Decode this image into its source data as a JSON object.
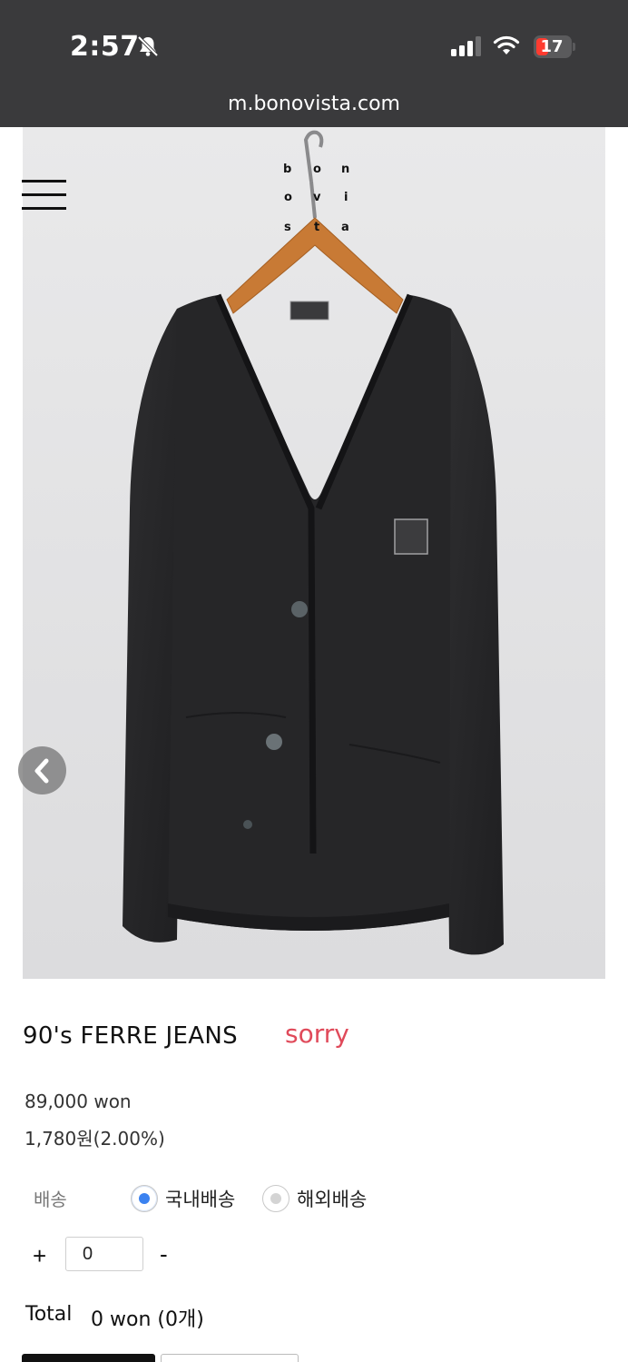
{
  "status_bar": {
    "time": "2:57",
    "battery": "17",
    "url": "m.bonovista.com"
  },
  "logo": {
    "letters": [
      "b",
      "o",
      "n",
      "o",
      "v",
      "i",
      "s",
      "t",
      "a"
    ]
  },
  "product": {
    "title": "90's FERRE JEANS",
    "status": "sorry",
    "price": "89,000 won",
    "points": "1,780원(2.00%)"
  },
  "shipping": {
    "label": "배송",
    "options": [
      {
        "label": "국내배송",
        "selected": true
      },
      {
        "label": "해외배송",
        "selected": false
      }
    ]
  },
  "quantity": {
    "plus": "+",
    "value": "0",
    "minus": "-"
  },
  "total": {
    "label": "Total",
    "value": "0 won (0개)"
  },
  "icons": {
    "menu": "hamburger-menu-icon",
    "prev": "chevron-left-icon",
    "bell": "bell-slash-icon",
    "signal": "cellular-signal-icon",
    "wifi": "wifi-icon",
    "battery": "battery-icon"
  },
  "colors": {
    "status_bar_bg": "#3a3a3c",
    "sorry": "#e04a5a",
    "radio_selected": "#3b82f0",
    "battery_low": "#ff3b30"
  }
}
